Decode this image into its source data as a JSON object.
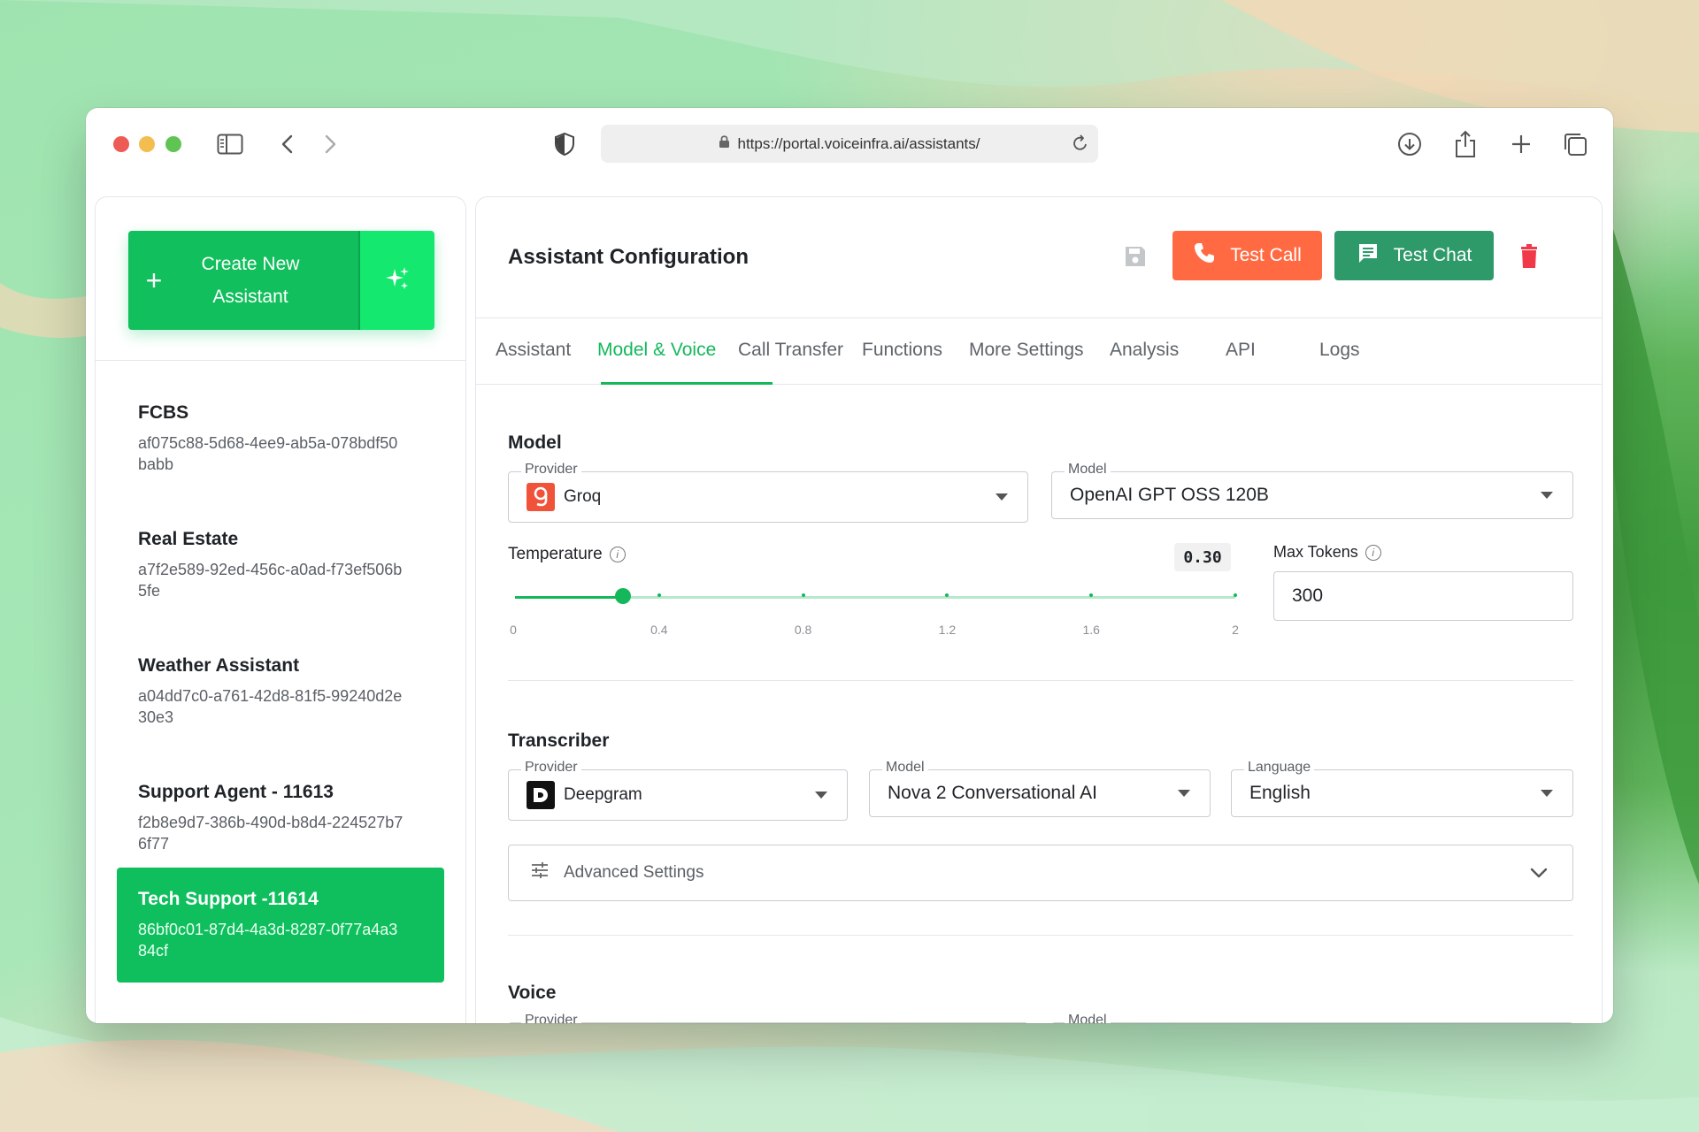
{
  "browser": {
    "url": "https://portal.voiceinfra.ai/assistants/"
  },
  "sidebar": {
    "create_button": {
      "label_line1": "Create New",
      "label_line2": "Assistant",
      "icon": "plus-icon",
      "ai_icon": "sparkles-icon"
    },
    "assistants": [
      {
        "name": "FCBS",
        "id": "af075c88-5d68-4ee9-ab5a-078bdf50babb"
      },
      {
        "name": "Real Estate",
        "id": "a7f2e589-92ed-456c-a0ad-f73ef506b5fe"
      },
      {
        "name": "Weather Assistant",
        "id": "a04dd7c0-a761-42d8-81f5-99240d2e30e3"
      },
      {
        "name": "Support Agent - 11613",
        "id": "f2b8e9d7-386b-490d-b8d4-224527b76f77"
      },
      {
        "name": "Tech Support -11614",
        "id": "86bf0c01-87d4-4a3d-8287-0f77a4a384cf",
        "active": true
      }
    ]
  },
  "header": {
    "title": "Assistant Configuration",
    "test_call_label": "Test Call",
    "test_chat_label": "Test Chat",
    "colors": {
      "test_call": "#ff6a42",
      "test_chat": "#2e9a6a",
      "delete": "#f03a4a"
    }
  },
  "tabs": [
    {
      "label": "Assistant"
    },
    {
      "label": "Model & Voice",
      "active": true
    },
    {
      "label": "Call Transfer"
    },
    {
      "label": "Functions"
    },
    {
      "label": "More Settings"
    },
    {
      "label": "Analysis"
    },
    {
      "label": "API"
    },
    {
      "label": "Logs"
    }
  ],
  "model_section": {
    "title": "Model",
    "provider": {
      "label": "Provider",
      "value": "Groq"
    },
    "model": {
      "label": "Model",
      "value": "OpenAI GPT OSS 120B"
    },
    "temperature": {
      "label": "Temperature",
      "value_text": "0.30",
      "value": 0.3,
      "min": 0,
      "max": 2,
      "ticks": [
        "0",
        "0.4",
        "0.8",
        "1.2",
        "1.6",
        "2"
      ]
    },
    "max_tokens": {
      "label": "Max Tokens",
      "value": "300"
    }
  },
  "transcriber_section": {
    "title": "Transcriber",
    "provider": {
      "label": "Provider",
      "value": "Deepgram"
    },
    "model": {
      "label": "Model",
      "value": "Nova 2 Conversational AI"
    },
    "language": {
      "label": "Language",
      "value": "English"
    },
    "advanced_label": "Advanced Settings"
  },
  "voice_section": {
    "title": "Voice",
    "provider_label": "Provider",
    "model_label": "Model"
  },
  "accent_color": "#14b85b"
}
